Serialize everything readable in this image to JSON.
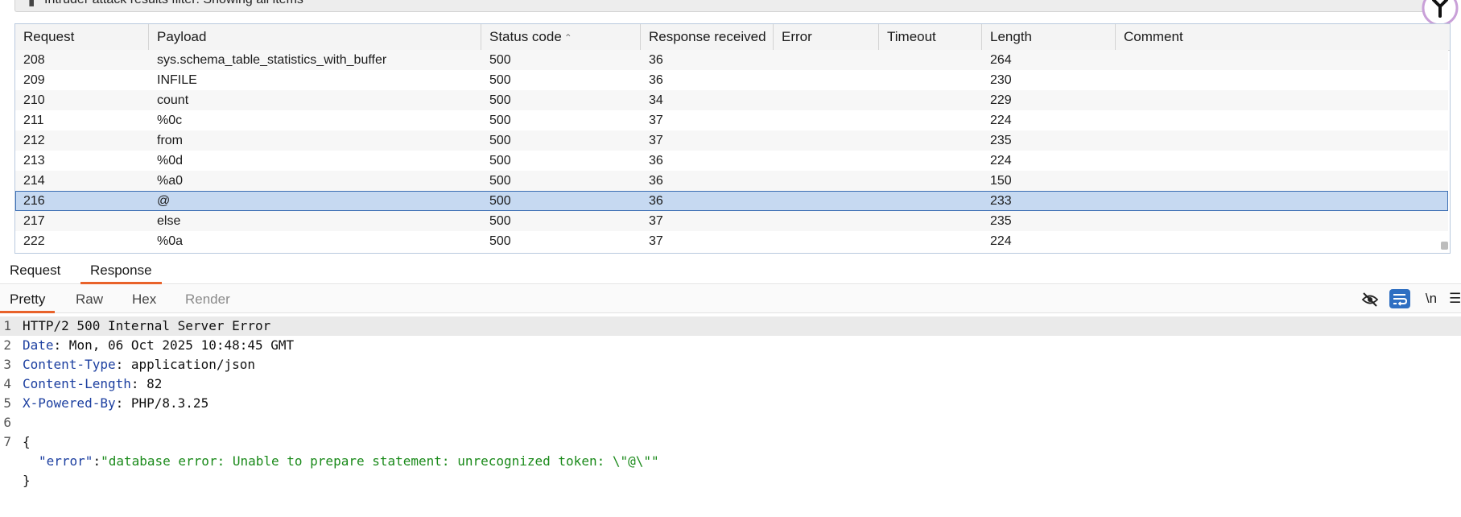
{
  "filter": {
    "text": "Intruder attack results filter: Showing all items"
  },
  "table": {
    "headers": [
      "Request",
      "Payload",
      "Status code",
      "Response received",
      "Error",
      "Timeout",
      "Length",
      "Comment"
    ],
    "rows": [
      [
        "208",
        "sys.schema_table_statistics_with_buffer",
        "500",
        "36",
        "",
        "",
        "264",
        ""
      ],
      [
        "209",
        "INFILE",
        "500",
        "36",
        "",
        "",
        "230",
        ""
      ],
      [
        "210",
        "count",
        "500",
        "34",
        "",
        "",
        "229",
        ""
      ],
      [
        "211",
        "%0c",
        "500",
        "37",
        "",
        "",
        "224",
        ""
      ],
      [
        "212",
        "from",
        "500",
        "37",
        "",
        "",
        "235",
        ""
      ],
      [
        "213",
        "%0d",
        "500",
        "36",
        "",
        "",
        "224",
        ""
      ],
      [
        "214",
        "%a0",
        "500",
        "36",
        "",
        "",
        "150",
        ""
      ],
      [
        "216",
        "@",
        "500",
        "36",
        "",
        "",
        "233",
        ""
      ],
      [
        "217",
        "else",
        "500",
        "37",
        "",
        "",
        "235",
        ""
      ],
      [
        "222",
        "%0a",
        "500",
        "37",
        "",
        "",
        "224",
        ""
      ]
    ],
    "selected_request": "216",
    "sort_column": "Status code"
  },
  "message_tabs": {
    "items": [
      "Request",
      "Response"
    ],
    "active": "Response"
  },
  "view_tabs": {
    "items": [
      "Pretty",
      "Raw",
      "Hex",
      "Render"
    ],
    "active": "Pretty",
    "disabled": "Render"
  },
  "toolbar": {
    "newline_label": "\\n"
  },
  "response": {
    "lines": [
      {
        "n": "1",
        "text": "HTTP/2 500 Internal Server Error"
      },
      {
        "n": "2",
        "key": "Date",
        "value": " Mon, 06 Oct 2025 10:48:45 GMT"
      },
      {
        "n": "3",
        "key": "Content-Type",
        "value": " application/json"
      },
      {
        "n": "4",
        "key": "Content-Length",
        "value": " 82"
      },
      {
        "n": "5",
        "key": "X-Powered-By",
        "value": " PHP/8.3.25"
      },
      {
        "n": "6",
        "text": ""
      },
      {
        "n": "7",
        "text": "{"
      },
      {
        "n": "",
        "json_key": "\"error\"",
        "json_value": "\"database error: Unable to prepare statement: unrecognized token: \\\"@\\\"\""
      },
      {
        "n": "",
        "text": "}"
      }
    ]
  },
  "colors": {
    "accent": "#e8622a",
    "selection": "#c6d9f1",
    "header_key": "#1c3fa0",
    "json_string": "#1a8a1a"
  }
}
